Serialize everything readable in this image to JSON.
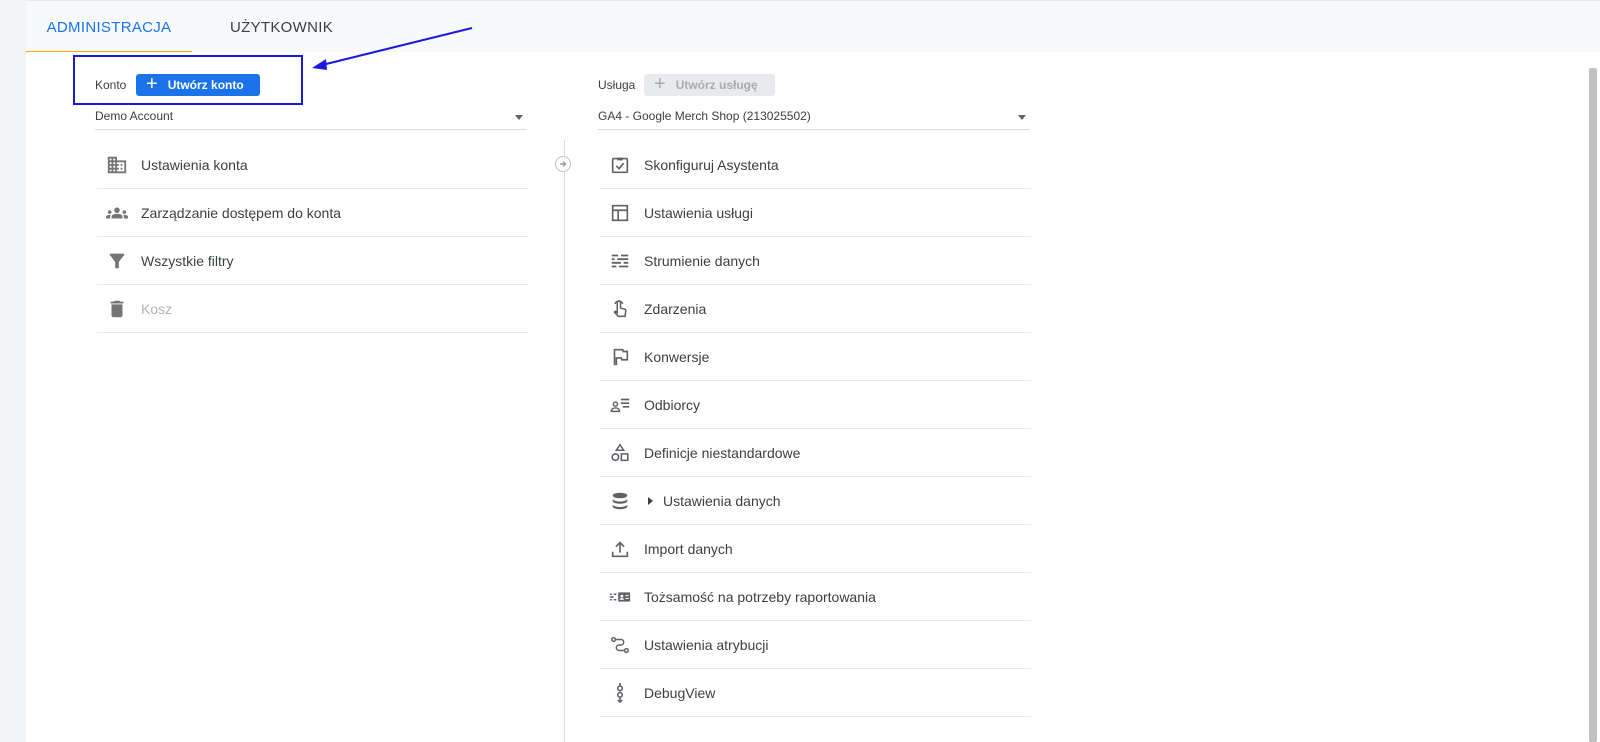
{
  "tabs": {
    "admin": "ADMINISTRACJA",
    "user": "UŻYTKOWNIK"
  },
  "account": {
    "label": "Konto",
    "create_button": "Utwórz konto",
    "selected": "Demo Account",
    "items": [
      {
        "label": "Ustawienia konta",
        "icon": "building-icon"
      },
      {
        "label": "Zarządzanie dostępem do konta",
        "icon": "people-icon"
      },
      {
        "label": "Wszystkie filtry",
        "icon": "filter-icon"
      },
      {
        "label": "Kosz",
        "icon": "trash-icon"
      }
    ]
  },
  "property": {
    "label": "Usługa",
    "create_button": "Utwórz usługę",
    "selected": "GA4 - Google Merch Shop (213025502)",
    "items": [
      {
        "label": "Skonfiguruj Asystenta",
        "icon": "checkbox-clipboard-icon"
      },
      {
        "label": "Ustawienia usługi",
        "icon": "layout-icon"
      },
      {
        "label": "Strumienie danych",
        "icon": "streams-icon"
      },
      {
        "label": "Zdarzenia",
        "icon": "touch-icon"
      },
      {
        "label": "Konwersje",
        "icon": "flag-icon"
      },
      {
        "label": "Odbiorcy",
        "icon": "audience-icon"
      },
      {
        "label": "Definicje niestandardowe",
        "icon": "shapes-icon"
      },
      {
        "label": "Ustawienia danych",
        "icon": "database-icon"
      },
      {
        "label": "Import danych",
        "icon": "upload-icon"
      },
      {
        "label": "Tożsamość na potrzeby raportowania",
        "icon": "identity-icon"
      },
      {
        "label": "Ustawienia atrybucji",
        "icon": "attribution-icon"
      },
      {
        "label": "DebugView",
        "icon": "debug-icon"
      }
    ]
  },
  "colors": {
    "accent": "#1a73e8",
    "tab_indicator": "#f9ab00",
    "highlight": "#1a1adf"
  }
}
